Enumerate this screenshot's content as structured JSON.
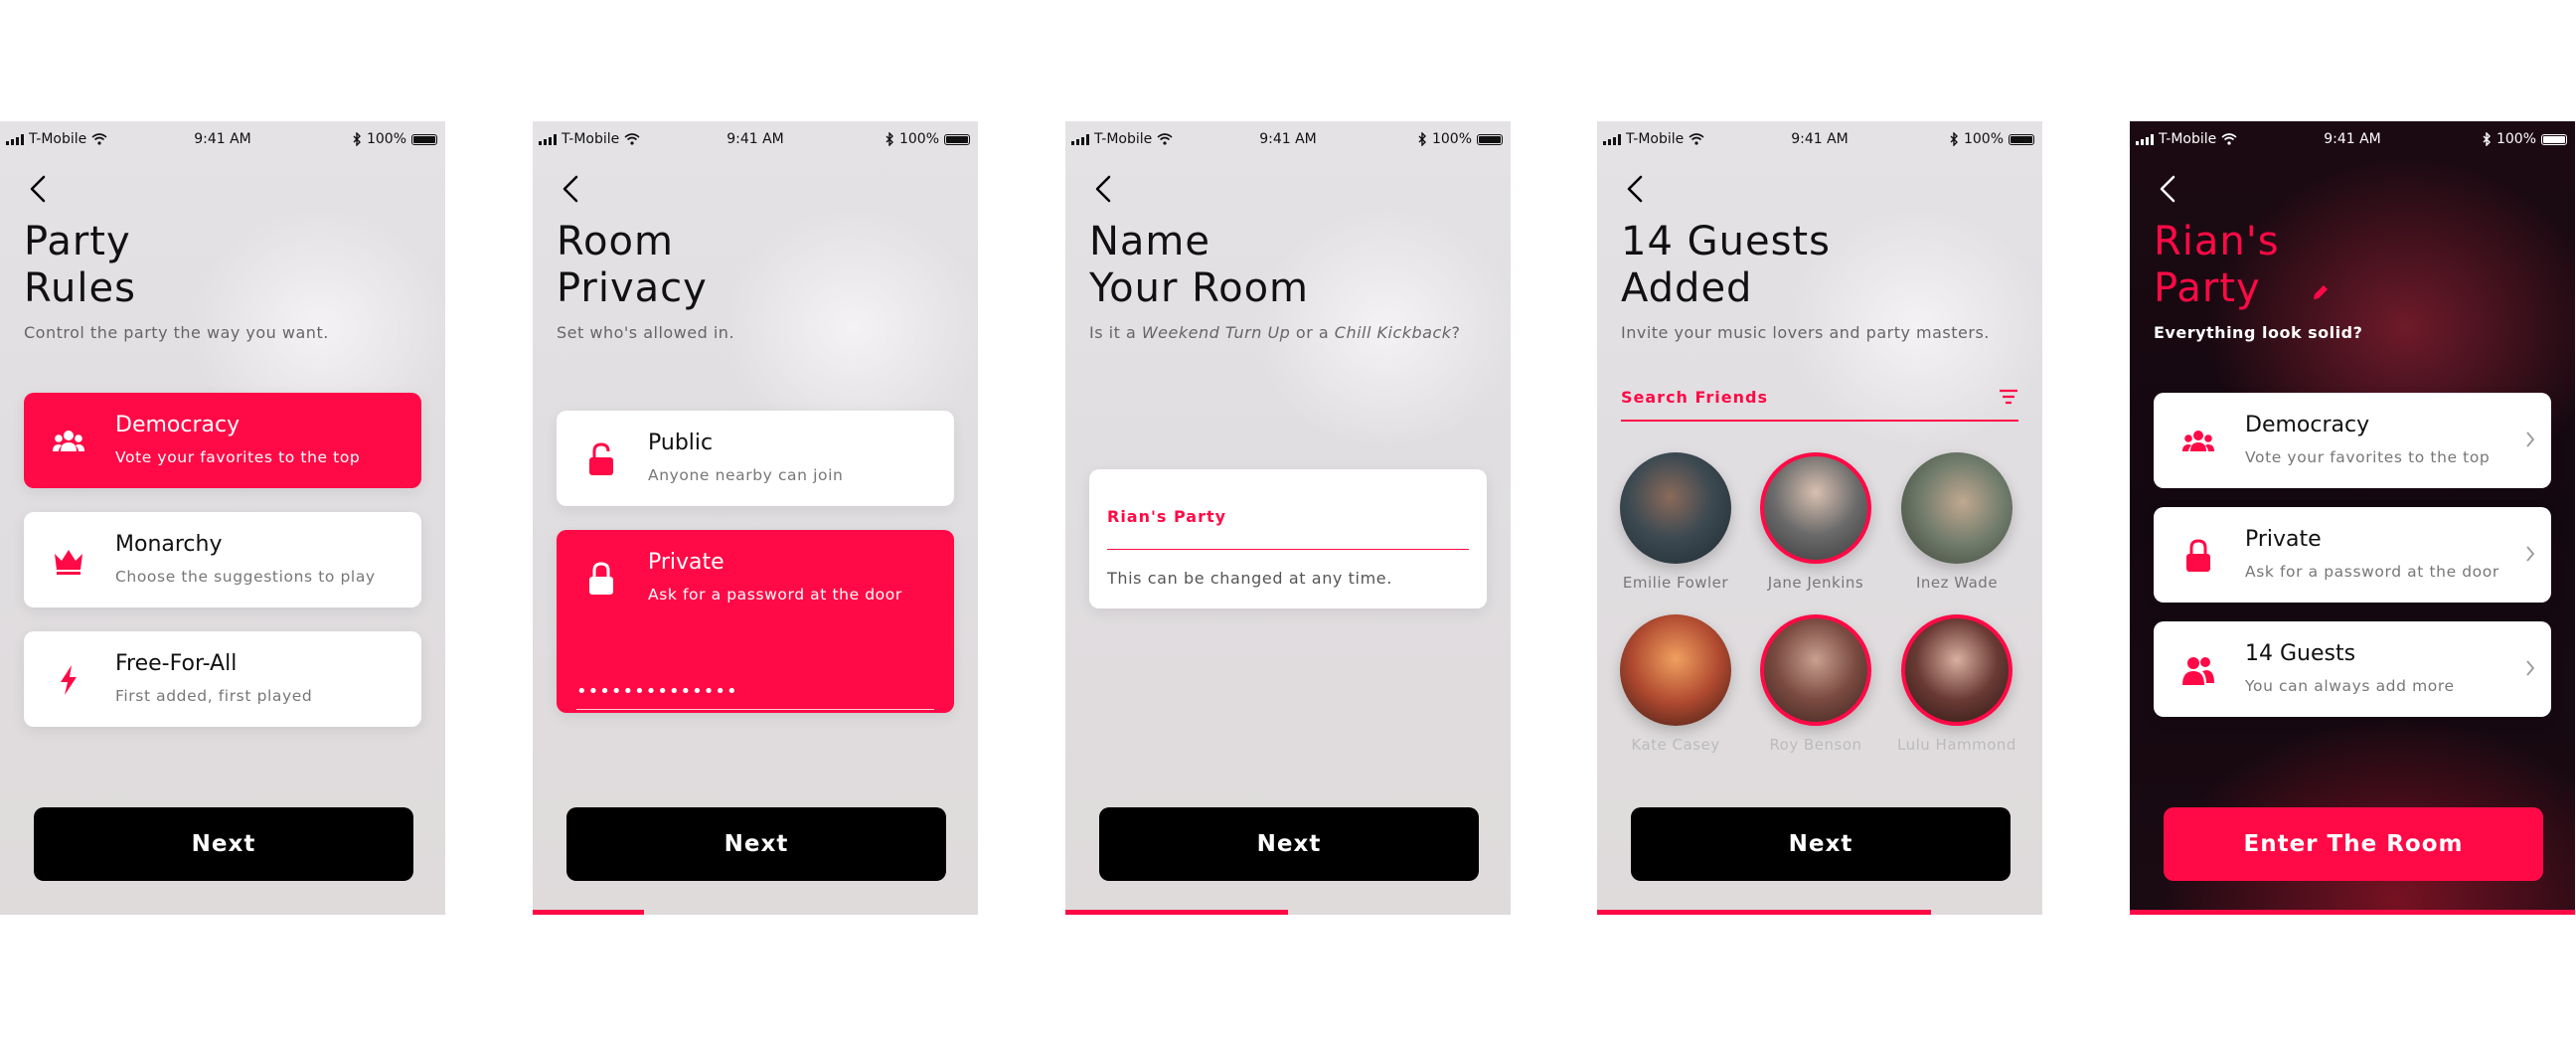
{
  "status": {
    "carrier": "T-Mobile",
    "time": "9:41 AM",
    "battery": "100%"
  },
  "accent": "#ff0a46",
  "screens": [
    {
      "title": "Party\nRules",
      "subtitle": "Control the party the way you want.",
      "options": [
        {
          "label": "Democracy",
          "sub": "Vote your favorites to the top",
          "icon": "group-icon",
          "selected": true
        },
        {
          "label": "Monarchy",
          "sub": "Choose the suggestions to play",
          "icon": "crown-icon",
          "selected": false
        },
        {
          "label": "Free-For-All",
          "sub": "First added, first played",
          "icon": "lightning-icon",
          "selected": false
        }
      ],
      "button": "Next",
      "progress": 0
    },
    {
      "title": "Room\nPrivacy",
      "subtitle": "Set who's allowed in.",
      "options": [
        {
          "label": "Public",
          "sub": "Anyone nearby can join",
          "icon": "unlock-icon",
          "selected": false
        },
        {
          "label": "Private",
          "sub": "Ask for a password at the door",
          "icon": "lock-icon",
          "selected": true,
          "password": "••••••••••••••"
        }
      ],
      "button": "Next",
      "progress": 0.25
    },
    {
      "title": "Name\nYour Room",
      "subtitle_parts": [
        "Is it a ",
        "Weekend Turn Up",
        " or a ",
        "Chill Kickback",
        "?"
      ],
      "field_value": "Rian's Party",
      "field_hint": "This can be changed at any time.",
      "button": "Next",
      "progress": 0.5
    },
    {
      "title": "14 Guests\nAdded",
      "subtitle": "Invite your music lovers and party masters.",
      "search_placeholder": "Search Friends",
      "guests": [
        {
          "name": "Emilie Fowler",
          "selected": false
        },
        {
          "name": "Jane Jenkins",
          "selected": true
        },
        {
          "name": "Inez Wade",
          "selected": false
        },
        {
          "name": "Kate Casey",
          "selected": false
        },
        {
          "name": "Roy Benson",
          "selected": true
        },
        {
          "name": "Lulu Hammond",
          "selected": true
        }
      ],
      "button": "Next",
      "progress": 0.75
    },
    {
      "title": "Rian's\nParty",
      "subtitle": "Everything look solid?",
      "options": [
        {
          "label": "Democracy",
          "sub": "Vote your favorites to the top",
          "icon": "group-icon"
        },
        {
          "label": "Private",
          "sub": "Ask for a password at the door",
          "icon": "lock-icon"
        },
        {
          "label": "14 Guests",
          "sub": "You can always add more",
          "icon": "guests-icon"
        }
      ],
      "button": "Enter The Room",
      "progress": 1
    }
  ]
}
